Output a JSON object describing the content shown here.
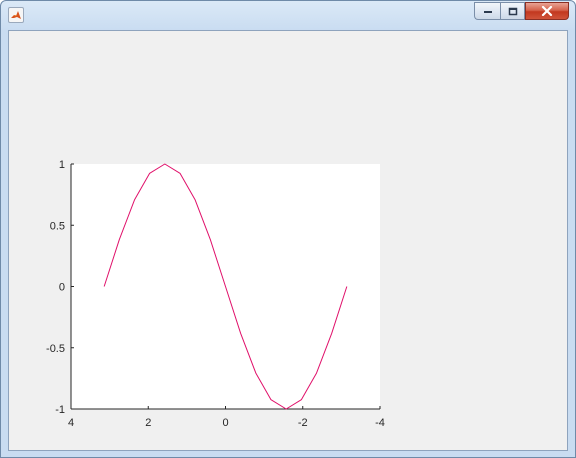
{
  "window": {
    "icon": "matlab-figure-icon",
    "controls": [
      "minimize-icon",
      "restore-icon",
      "close-icon"
    ],
    "close_color": "#c8432b"
  },
  "chart_data": {
    "type": "line",
    "title": "",
    "xlabel": "",
    "ylabel": "",
    "xlim": [
      4,
      -4
    ],
    "x_direction": "reversed",
    "ylim": [
      -1,
      1
    ],
    "x_ticks": [
      "4",
      "2",
      "0",
      "-2",
      "-4"
    ],
    "y_ticks": [
      "1",
      "0.5",
      "0",
      "-0.5",
      "-1"
    ],
    "grid": false,
    "series": [
      {
        "color": "#e0106a",
        "x": [
          3.1416,
          2.7489,
          2.3562,
          1.9635,
          1.5708,
          1.1781,
          0.7854,
          0.3927,
          0,
          -0.3927,
          -0.7854,
          -1.1781,
          -1.5708,
          -1.9635,
          -2.3562,
          -2.7489,
          -3.1416
        ],
        "y": [
          0,
          0.383,
          0.707,
          0.924,
          1,
          0.924,
          0.707,
          0.383,
          0,
          -0.383,
          -0.707,
          -0.924,
          -1,
          -0.924,
          -0.707,
          -0.383,
          0
        ]
      }
    ]
  }
}
